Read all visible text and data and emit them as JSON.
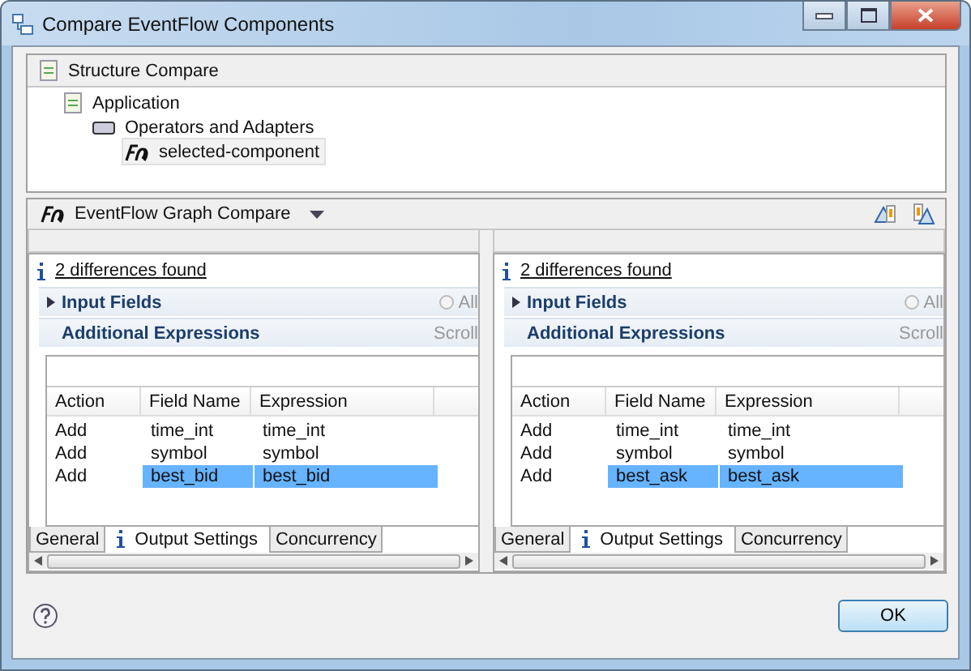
{
  "window": {
    "title": "Compare EventFlow Components"
  },
  "structure_compare": {
    "title": "Structure Compare",
    "tree": [
      {
        "label": "Application",
        "kind": "document",
        "children": [
          {
            "label": "Operators and Adapters",
            "kind": "component",
            "children": [
              {
                "label": "selected-component",
                "kind": "eventflow",
                "selected": true
              }
            ]
          }
        ]
      }
    ]
  },
  "graph_compare": {
    "title": "EventFlow Graph Compare"
  },
  "panes": [
    {
      "differences": "2 differences found",
      "sections": [
        {
          "label": "Input Fields",
          "expanded": false,
          "checked": false,
          "option": "All"
        },
        {
          "label": "Additional Expressions",
          "expanded": true,
          "option": "Scroll"
        }
      ],
      "columns": [
        "Action",
        "Field Name",
        "Expression"
      ],
      "rows": [
        {
          "cells": [
            "Add",
            "time_int",
            "time_int"
          ],
          "selected": false
        },
        {
          "cells": [
            "Add",
            "symbol",
            "symbol"
          ],
          "selected": false
        },
        {
          "cells": [
            "Add",
            "best_bid",
            "best_bid"
          ],
          "selected": true
        }
      ],
      "tabs": [
        {
          "label": "General",
          "selected": false,
          "info": false
        },
        {
          "label": "Output Settings",
          "selected": true,
          "info": true
        },
        {
          "label": "Concurrency",
          "selected": false,
          "info": false
        }
      ]
    },
    {
      "differences": "2 differences found",
      "sections": [
        {
          "label": "Input Fields",
          "expanded": false,
          "checked": false,
          "option": "All"
        },
        {
          "label": "Additional Expressions",
          "expanded": true,
          "option": "Scroll"
        }
      ],
      "columns": [
        "Action",
        "Field Name",
        "Expression"
      ],
      "rows": [
        {
          "cells": [
            "Add",
            "time_int",
            "time_int"
          ],
          "selected": false
        },
        {
          "cells": [
            "Add",
            "symbol",
            "symbol"
          ],
          "selected": false
        },
        {
          "cells": [
            "Add",
            "best_ask",
            "best_ask"
          ],
          "selected": true
        }
      ],
      "tabs": [
        {
          "label": "General",
          "selected": false,
          "info": false
        },
        {
          "label": "Output Settings",
          "selected": true,
          "info": true
        },
        {
          "label": "Concurrency",
          "selected": false,
          "info": false
        }
      ]
    }
  ],
  "buttons": [
    "OK"
  ]
}
